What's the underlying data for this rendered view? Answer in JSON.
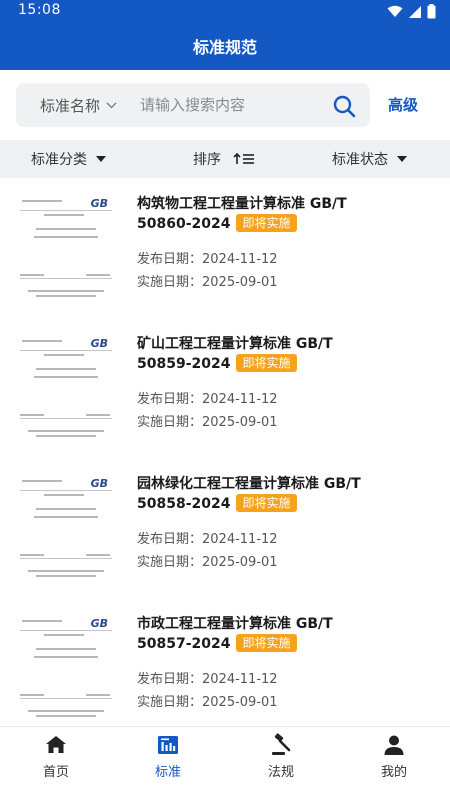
{
  "status_bar": {
    "time": "15:08"
  },
  "header": {
    "title": "标准规范"
  },
  "search": {
    "category_label": "标准名称",
    "placeholder": "请输入搜索内容",
    "advanced_label": "高级"
  },
  "filters": {
    "category": "标准分类",
    "sort": "排序",
    "status": "标准状态"
  },
  "standards": [
    {
      "title": "构筑物工程工程量计算标准 GB/T",
      "code": "50860-2024",
      "badge": "即将实施",
      "publish_date": "发布日期：2024-11-12",
      "effective_date": "实施日期：2025-09-01"
    },
    {
      "title": "矿山工程工程量计算标准 GB/T",
      "code": "50859-2024",
      "badge": "即将实施",
      "publish_date": "发布日期：2024-11-12",
      "effective_date": "实施日期：2025-09-01"
    },
    {
      "title": "园林绿化工程工程量计算标准 GB/T",
      "code": "50858-2024",
      "badge": "即将实施",
      "publish_date": "发布日期：2024-11-12",
      "effective_date": "实施日期：2025-09-01"
    },
    {
      "title": "市政工程工程量计算标准 GB/T",
      "code": "50857-2024",
      "badge": "即将实施",
      "publish_date": "发布日期：2024-11-12",
      "effective_date": "实施日期：2025-09-01"
    }
  ],
  "thumbnail_logo": "GB",
  "tabbar": {
    "items": [
      {
        "label": "首页",
        "icon": "home-icon"
      },
      {
        "label": "标准",
        "icon": "standards-icon",
        "active": true
      },
      {
        "label": "法规",
        "icon": "gavel-icon"
      },
      {
        "label": "我的",
        "icon": "user-icon"
      }
    ]
  },
  "colors": {
    "primary": "#1458c4",
    "badge": "#f7a21d",
    "filter_bg": "#eef0f3"
  }
}
